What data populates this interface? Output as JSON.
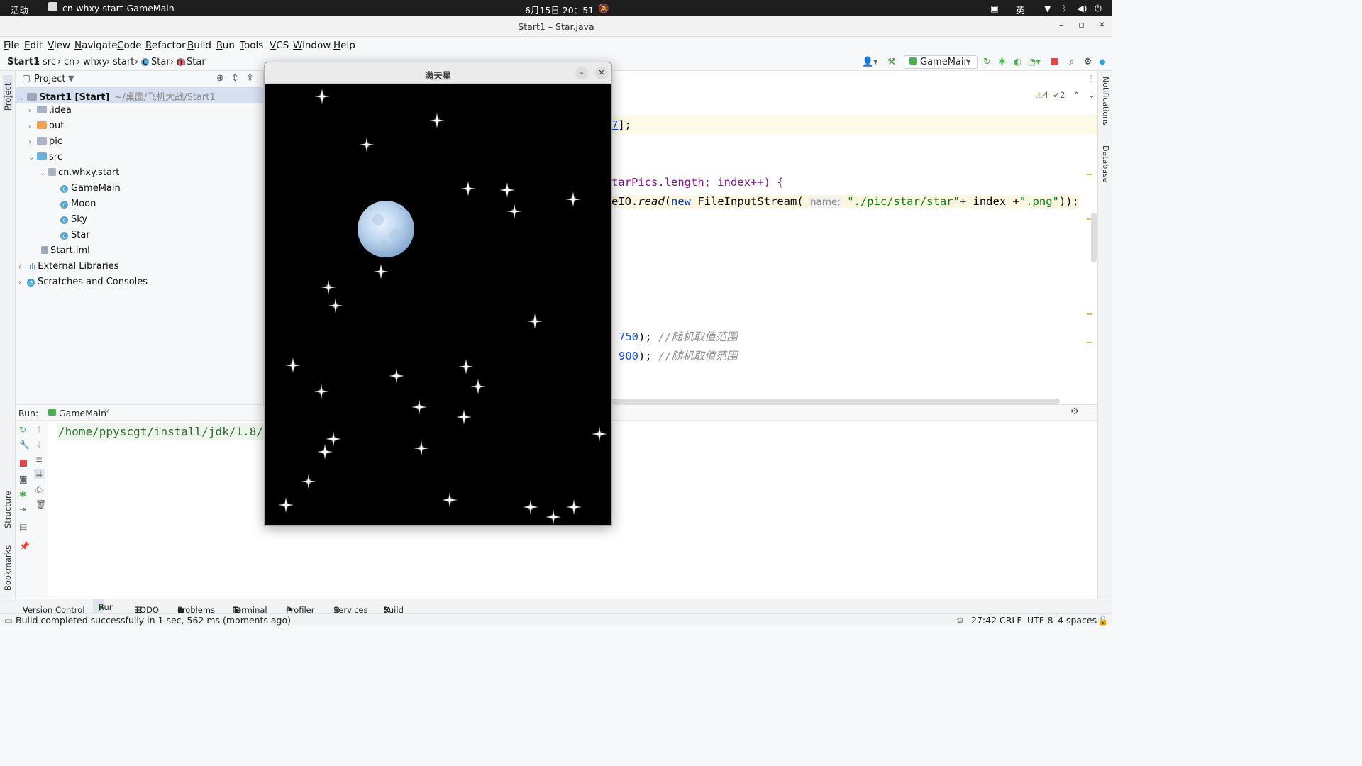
{
  "topbar": {
    "activities": "活动",
    "app_name": "cn-whxy-start-GameMain",
    "clock": "6月15日 20：51",
    "ime": "英"
  },
  "window": {
    "title": "Start1 – Star.java"
  },
  "menu": [
    "File",
    "Edit",
    "View",
    "Navigate",
    "Code",
    "Refactor",
    "Build",
    "Run",
    "Tools",
    "VCS",
    "Window",
    "Help"
  ],
  "breadcrumb": {
    "project": "Start1",
    "parts": [
      "src",
      "cn",
      "whxy",
      "start",
      "Star",
      "Star"
    ]
  },
  "run_config": "GameMain",
  "project_panel": {
    "title": "Project",
    "root_name": "Start1 [Start]",
    "root_path": "~/桌面/飞机大战/Start1",
    "items": [
      ".idea",
      "out",
      "pic",
      "src",
      "cn.whxy.start",
      "GameMain",
      "Moon",
      "Sky",
      "Star",
      "Start.iml",
      "External Libraries",
      "Scratches and Consoles"
    ]
  },
  "editor": {
    "warnings": "4",
    "checks": "2",
    "line1_tail": "];",
    "line2_tail": "tarPics.length; index++) {",
    "line3_prefix": "eIO.",
    "line3_read": "read",
    "line3_new": "new",
    "line3_fis": "FileInputStream(",
    "line3_hint": "name:",
    "line3_str1": "\"./pic/star/star\"",
    "line3_plus1": "+",
    "line3_index": "index",
    "line3_plus2": "+",
    "line3_str2": "\".png\"",
    "line3_end": "));",
    "line4_num": "750",
    "line4_end": ");",
    "line4_comment": "//随机取值范围",
    "line5_num": "900",
    "line5_end": ");",
    "line5_comment": "//随机取值范围"
  },
  "run_panel": {
    "label": "Run:",
    "tab": "GameMain",
    "output": "/home/ppyscgt/install/jdk/1.8/"
  },
  "bottom_tabs": [
    "Version Control",
    "Run",
    "TODO",
    "Problems",
    "Terminal",
    "Profiler",
    "Services",
    "Build"
  ],
  "status": {
    "message": "Build completed successfully in 1 sec, 562 ms (moments ago)",
    "position": "27:42",
    "line_sep": "CRLF",
    "encoding": "UTF-8",
    "indent": "4 spaces"
  },
  "side_tabs": {
    "project": "Project",
    "structure": "Structure",
    "bookmarks": "Bookmarks",
    "notifications": "Notifications",
    "database": "Database"
  },
  "star_window": {
    "title": "满天星"
  }
}
